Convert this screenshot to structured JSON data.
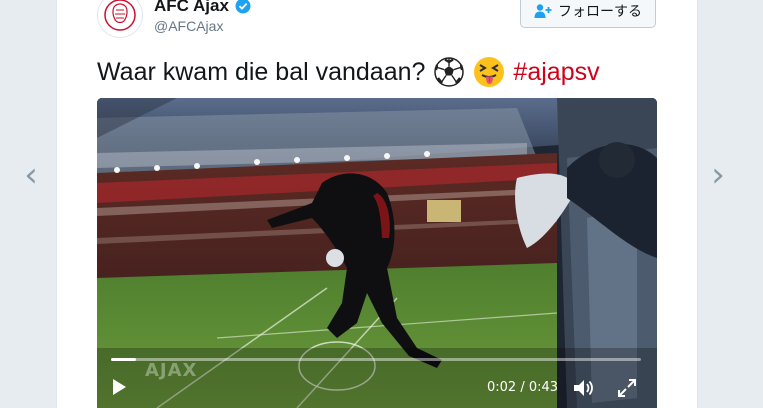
{
  "navigation": {
    "prev_icon": "chevron-left-icon",
    "next_icon": "chevron-right-icon"
  },
  "tweet": {
    "display_name": "AFC Ajax",
    "handle": "@AFCAjax",
    "follow_label": "フォローする",
    "text": "Waar kwam die bal vandaan?",
    "emojis": [
      "soccer-ball-emoji",
      "squinting-tongue-face-emoji"
    ],
    "hashtag": "#ajapsv",
    "verified_icon": "verified-badge-icon"
  },
  "video": {
    "watermark": "AJAX",
    "current_time": "0:02",
    "duration": "0:43",
    "time_display": "0:02 / 0:43",
    "progress_fraction": 0.047
  },
  "colors": {
    "background": "#e6ecf0",
    "hashtag": "#d0021b",
    "verified": "#1da1f2"
  }
}
